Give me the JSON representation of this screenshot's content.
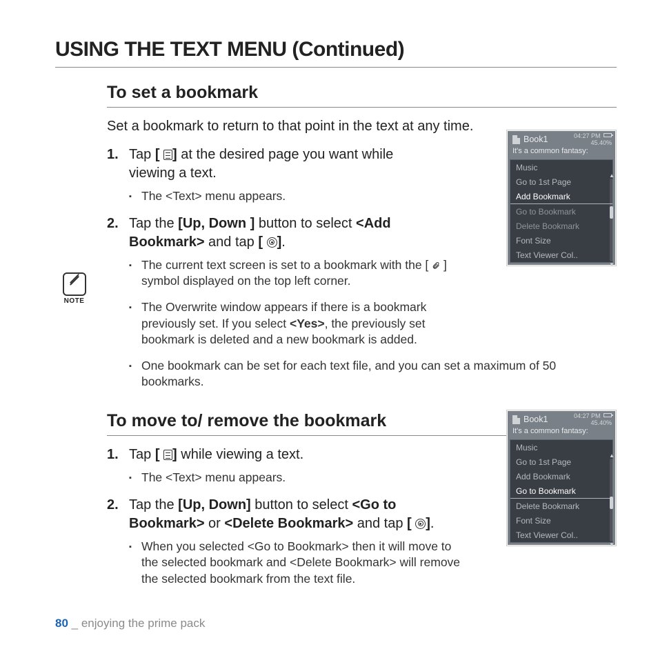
{
  "page": {
    "title": "USING THE TEXT MENU (Continued)",
    "footer_page": "80",
    "footer_sep": " _ ",
    "footer_text": "enjoying the prime pack"
  },
  "section1": {
    "heading": "To set a bookmark",
    "lead": "Set a bookmark to return to that point in the text at any time.",
    "step1_num": "1.",
    "step1_a": "Tap ",
    "step1_b": "[",
    "step1_c": "]",
    "step1_d": " at the desired page you want while viewing a text.",
    "step1_sub": "The <Text> menu appears.",
    "step2_num": "2.",
    "step2_a": "Tap the ",
    "step2_b": "[Up, Down ]",
    "step2_c": " button to select ",
    "step2_d": "<Add Bookmark>",
    "step2_e": " and tap ",
    "step2_f": "[",
    "step2_g": "]",
    "step2_h": ".",
    "step2_sub1_a": "The current text screen is set to a bookmark with the [",
    "step2_sub1_b": "] symbol displayed on the top left corner.",
    "note_label": "NOTE",
    "note_item1_a": "The Overwrite window appears if there is a bookmark previously set. If you select ",
    "note_item1_b": "<Yes>",
    "note_item1_c": ", the previously set bookmark is deleted and a new bookmark is added.",
    "note_item2": "One bookmark can be set for each text file, and you can set a maximum of 50 bookmarks."
  },
  "section2": {
    "heading": "To move to/ remove the bookmark",
    "step1_num": "1.",
    "step1_a": "Tap ",
    "step1_b": "[",
    "step1_c": "]",
    "step1_d": " while viewing a text.",
    "step1_sub": "The <Text> menu appears.",
    "step2_num": "2.",
    "step2_a": "Tap the ",
    "step2_b": "[Up, Down]",
    "step2_c": " button to select ",
    "step2_d": "<Go to Bookmark>",
    "step2_e": " or ",
    "step2_f": "<Delete Bookmark>",
    "step2_g": " and tap ",
    "step2_h": "[",
    "step2_i": "]",
    "step2_j": ".",
    "step2_sub": "When you selected <Go to Bookmark> then it will move to the selected bookmark and <Delete Bookmark> will remove the selected bookmark from the text file."
  },
  "device": {
    "book": "Book1",
    "time": "04:27 PM",
    "percent": "45.40%",
    "excerpt": "It's a common fantasy:",
    "menu": {
      "music": "Music",
      "first": "Go to 1st Page",
      "add": "Add Bookmark",
      "goto": "Go to Bookmark",
      "delete": "Delete Bookmark",
      "font": "Font Size",
      "color": "Text Viewer Col.."
    }
  }
}
